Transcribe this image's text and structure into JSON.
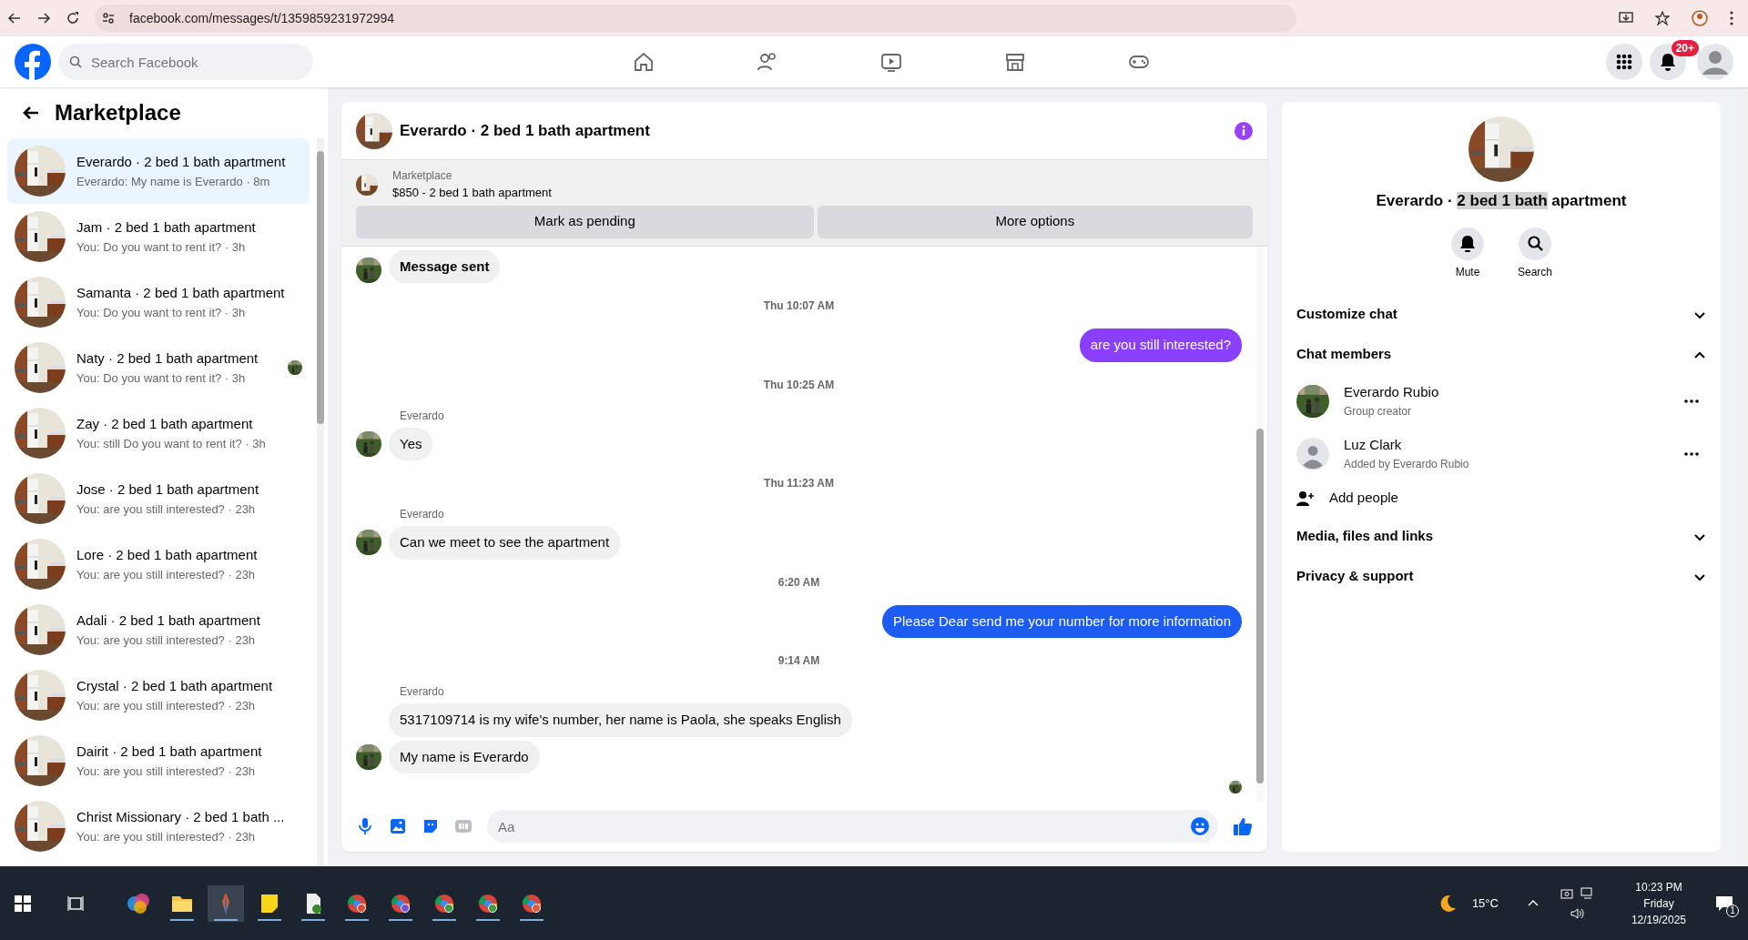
{
  "browser": {
    "url": "facebook.com/messages/t/1359859231972994"
  },
  "topbar": {
    "search_placeholder": "Search Facebook",
    "notification_count": "20+"
  },
  "sidebar": {
    "title": "Marketplace",
    "items": [
      {
        "title": "Everardo · 2 bed 1 bath apartment",
        "preview": "Everardo: My name is Everardo · 8m",
        "selected": true,
        "seen": false
      },
      {
        "title": "Jam · 2 bed 1 bath apartment",
        "preview": "You: Do you want to rent it? · 3h",
        "selected": false,
        "seen": false
      },
      {
        "title": "Samanta · 2 bed 1 bath apartment",
        "preview": "You: Do you want to rent it? · 3h",
        "selected": false,
        "seen": false
      },
      {
        "title": "Naty · 2 bed 1 bath apartment",
        "preview": "You: Do you want to rent it? · 3h",
        "selected": false,
        "seen": true
      },
      {
        "title": "Zay · 2 bed 1 bath apartment",
        "preview": "You: still Do you want to rent it? · 3h",
        "selected": false,
        "seen": false
      },
      {
        "title": "Jose · 2 bed 1 bath apartment",
        "preview": "You: are you still interested? · 23h",
        "selected": false,
        "seen": false
      },
      {
        "title": "Lore · 2 bed 1 bath apartment",
        "preview": "You: are you still interested? · 23h",
        "selected": false,
        "seen": false
      },
      {
        "title": "Adali · 2 bed 1 bath apartment",
        "preview": "You: are you still interested? · 23h",
        "selected": false,
        "seen": false
      },
      {
        "title": "Crystal · 2 bed 1 bath apartment",
        "preview": "You: are you still interested? · 23h",
        "selected": false,
        "seen": false
      },
      {
        "title": "Dairit · 2 bed 1 bath apartment",
        "preview": "You: are you still interested? · 23h",
        "selected": false,
        "seen": false
      },
      {
        "title": "Christ Missionary · 2 bed 1 bath ...",
        "preview": "You: are you still interested? · 23h",
        "selected": false,
        "seen": false
      }
    ]
  },
  "chat": {
    "title": "Everardo · 2 bed 1 bath apartment",
    "listing": {
      "label": "Marketplace",
      "text": "$850 - 2 bed 1 bath apartment"
    },
    "buttons": [
      "Mark as pending",
      "More options"
    ],
    "messages": [
      {
        "kind": "notice",
        "text": "Message sent"
      },
      {
        "kind": "time",
        "text": "Thu 10:07 AM"
      },
      {
        "kind": "outgoing",
        "text": "are you still interested?",
        "color": "#8a3ffc"
      },
      {
        "kind": "time",
        "text": "Thu 10:25 AM"
      },
      {
        "kind": "incoming",
        "sender": "Everardo",
        "texts": [
          "Yes"
        ]
      },
      {
        "kind": "time",
        "text": "Thu 11:23 AM"
      },
      {
        "kind": "incoming",
        "sender": "Everardo",
        "texts": [
          "Can we meet to see the apartment"
        ]
      },
      {
        "kind": "time",
        "text": "6:20 AM"
      },
      {
        "kind": "outgoing",
        "text": "Please Dear send me your number for more information",
        "color": "#1d5cf0"
      },
      {
        "kind": "time",
        "text": "9:14 AM"
      },
      {
        "kind": "incoming",
        "sender": "Everardo",
        "texts": [
          "5317109714 is my wife's number, her name is Paola, she speaks English",
          "My name is Everardo"
        ]
      }
    ],
    "seen": true,
    "composer": {
      "placeholder": "Aa"
    }
  },
  "details": {
    "title": [
      {
        "text": "Everardo · ",
        "selected": false
      },
      {
        "text": "2 bed 1 bath",
        "selected": true
      },
      {
        "text": " apartment",
        "selected": false
      }
    ],
    "actions": [
      {
        "kind": "bell",
        "label": "Mute"
      },
      {
        "kind": "search",
        "label": "Search"
      }
    ],
    "sections": [
      {
        "label": "Customize chat",
        "expanded": false
      },
      {
        "label": "Chat members",
        "expanded": true,
        "members": [
          {
            "name": "Everardo Rubio",
            "role": "Group creator"
          },
          {
            "name": "Luz Clark",
            "role": "Added by Everardo Rubio",
            "kind": "default"
          }
        ],
        "add_label": "Add people"
      },
      {
        "label": "Media, files and links",
        "expanded": false
      },
      {
        "label": "Privacy & support",
        "expanded": false
      }
    ]
  },
  "taskbar": {
    "weather": "15°C",
    "time": "10:23 PM",
    "day": "Friday",
    "date": "12/19/2025",
    "notifications": "1"
  }
}
